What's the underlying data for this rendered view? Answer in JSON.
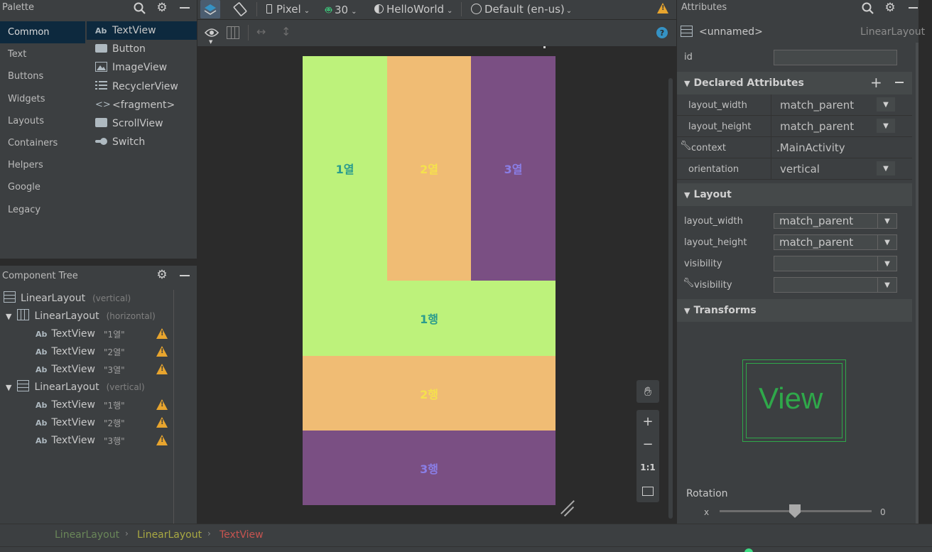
{
  "palette": {
    "title": "Palette",
    "categories": [
      "Common",
      "Text",
      "Buttons",
      "Widgets",
      "Layouts",
      "Containers",
      "Helpers",
      "Google",
      "Legacy"
    ],
    "items": [
      {
        "icon": "Ab",
        "label": "TextView"
      },
      {
        "icon": "button-icon",
        "label": "Button"
      },
      {
        "icon": "image-icon",
        "label": "ImageView"
      },
      {
        "icon": "list-icon",
        "label": "RecyclerView"
      },
      {
        "icon": "<>",
        "label": "<fragment>"
      },
      {
        "icon": "scroll-icon",
        "label": "ScrollView"
      },
      {
        "icon": "toggle-icon",
        "label": "Switch"
      }
    ]
  },
  "tree": {
    "title": "Component Tree",
    "nodes": [
      {
        "label": "LinearLayout",
        "sub": "(vertical)"
      },
      {
        "label": "LinearLayout",
        "sub": "(horizontal)"
      },
      {
        "label": "TextView",
        "q": "\"1열\""
      },
      {
        "label": "TextView",
        "q": "\"2열\""
      },
      {
        "label": "TextView",
        "q": "\"3열\""
      },
      {
        "label": "LinearLayout",
        "sub": "(vertical)"
      },
      {
        "label": "TextView",
        "q": "\"1행\""
      },
      {
        "label": "TextView",
        "q": "\"2행\""
      },
      {
        "label": "TextView",
        "q": "\"3행\""
      }
    ]
  },
  "toolbar": {
    "device": "Pixel",
    "api": "30",
    "theme": "HelloWorld",
    "locale": "Default (en-us)"
  },
  "preview": {
    "cols": [
      {
        "label": "1열",
        "bg": "#bdf27b",
        "fg": "#2b9c8d"
      },
      {
        "label": "2열",
        "bg": "#f0bc74",
        "fg": "#f5e14d"
      },
      {
        "label": "3열",
        "bg": "#7a4f83",
        "fg": "#8a7ee6"
      }
    ],
    "rows": [
      {
        "label": "1행",
        "bg": "#bdf27b",
        "fg": "#2b9c8d"
      },
      {
        "label": "2행",
        "bg": "#f0bc74",
        "fg": "#f5e14d"
      },
      {
        "label": "3행",
        "bg": "#7a4f83",
        "fg": "#8a7ee6"
      }
    ]
  },
  "zoom": {
    "one_to_one": "1:1"
  },
  "attributes": {
    "title": "Attributes",
    "name": "<unnamed>",
    "class": "LinearLayout",
    "id_label": "id",
    "declared_title": "Declared Attributes",
    "declared": [
      {
        "label": "layout_width",
        "value": "match_parent"
      },
      {
        "label": "layout_height",
        "value": "match_parent"
      },
      {
        "label": "context",
        "value": ".MainActivity"
      },
      {
        "label": "orientation",
        "value": "vertical"
      }
    ],
    "layout_title": "Layout",
    "layout": [
      {
        "label": "layout_width",
        "value": "match_parent"
      },
      {
        "label": "layout_height",
        "value": "match_parent"
      },
      {
        "label": "visibility",
        "value": ""
      },
      {
        "label": "visibility",
        "value": ""
      }
    ],
    "transforms_title": "Transforms",
    "view_text": "View",
    "rotation_label": "Rotation",
    "rotation_axis": "x",
    "rotation_value": "0"
  },
  "breadcrumb": [
    "LinearLayout",
    "LinearLayout",
    "TextView"
  ]
}
